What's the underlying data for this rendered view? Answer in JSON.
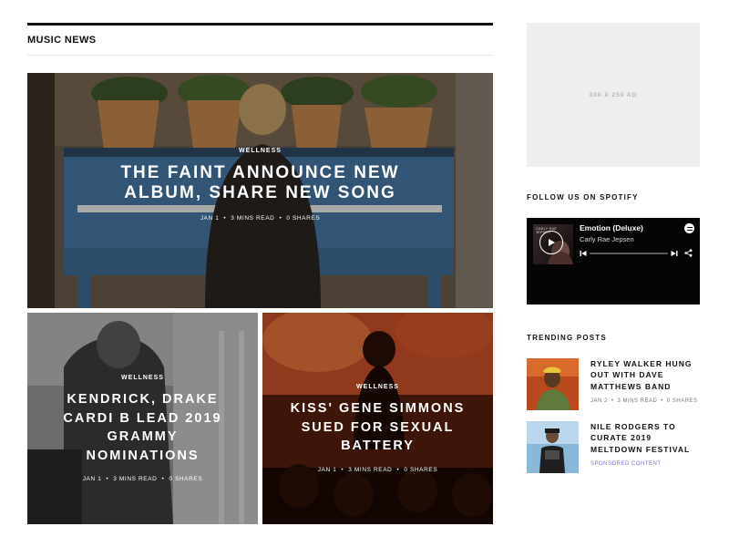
{
  "section": {
    "title": "MUSIC NEWS"
  },
  "featured": {
    "category": "WELLNESS",
    "headline": "THE FAINT ANNOUNCE NEW ALBUM, SHARE NEW SONG",
    "date": "JAN 1",
    "read_time": "3 MINS READ",
    "shares": "0 SHARES"
  },
  "articles": [
    {
      "category": "WELLNESS",
      "headline": "KENDRICK, DRAKE CARDI B LEAD 2019 GRAMMY NOMINATIONS",
      "date": "JAN 1",
      "read_time": "3 MINS READ",
      "shares": "0 SHARES"
    },
    {
      "category": "WELLNESS",
      "headline": "KISS' GENE SIMMONS SUED FOR SEXUAL BATTERY",
      "date": "JAN 1",
      "read_time": "3 MINS READ",
      "shares": "0 SHARES"
    }
  ],
  "sidebar": {
    "ad_label": "300 X 250 AD",
    "spotify_heading": "FOLLOW US ON SPOTIFY",
    "spotify": {
      "cover_text": "CARLY RAE JEPSEN",
      "track": "Emotion (Deluxe)",
      "artist": "Carly Rae Jepsen",
      "progress": 0,
      "icons": [
        "play-icon",
        "spotify-logo-icon",
        "previous-icon",
        "next-icon",
        "share-icon"
      ]
    },
    "trending_heading": "TRENDING POSTS",
    "trending": [
      {
        "title": "RYLEY WALKER HUNG OUT WITH DAVE MATTHEWS BAND",
        "date": "JAN 2",
        "read_time": "3 MINS READ",
        "shares": "0 SHARES"
      },
      {
        "title": "NILE RODGERS TO CURATE 2019 MELTDOWN FESTIVAL",
        "sponsored": "SPONSORED CONTENT"
      }
    ]
  },
  "colors": {
    "accent_purple": "#7c6cd8",
    "piano_blue": "#4a7aa8",
    "spotify_bg": "#050505",
    "ad_bg": "#eeeeee"
  }
}
